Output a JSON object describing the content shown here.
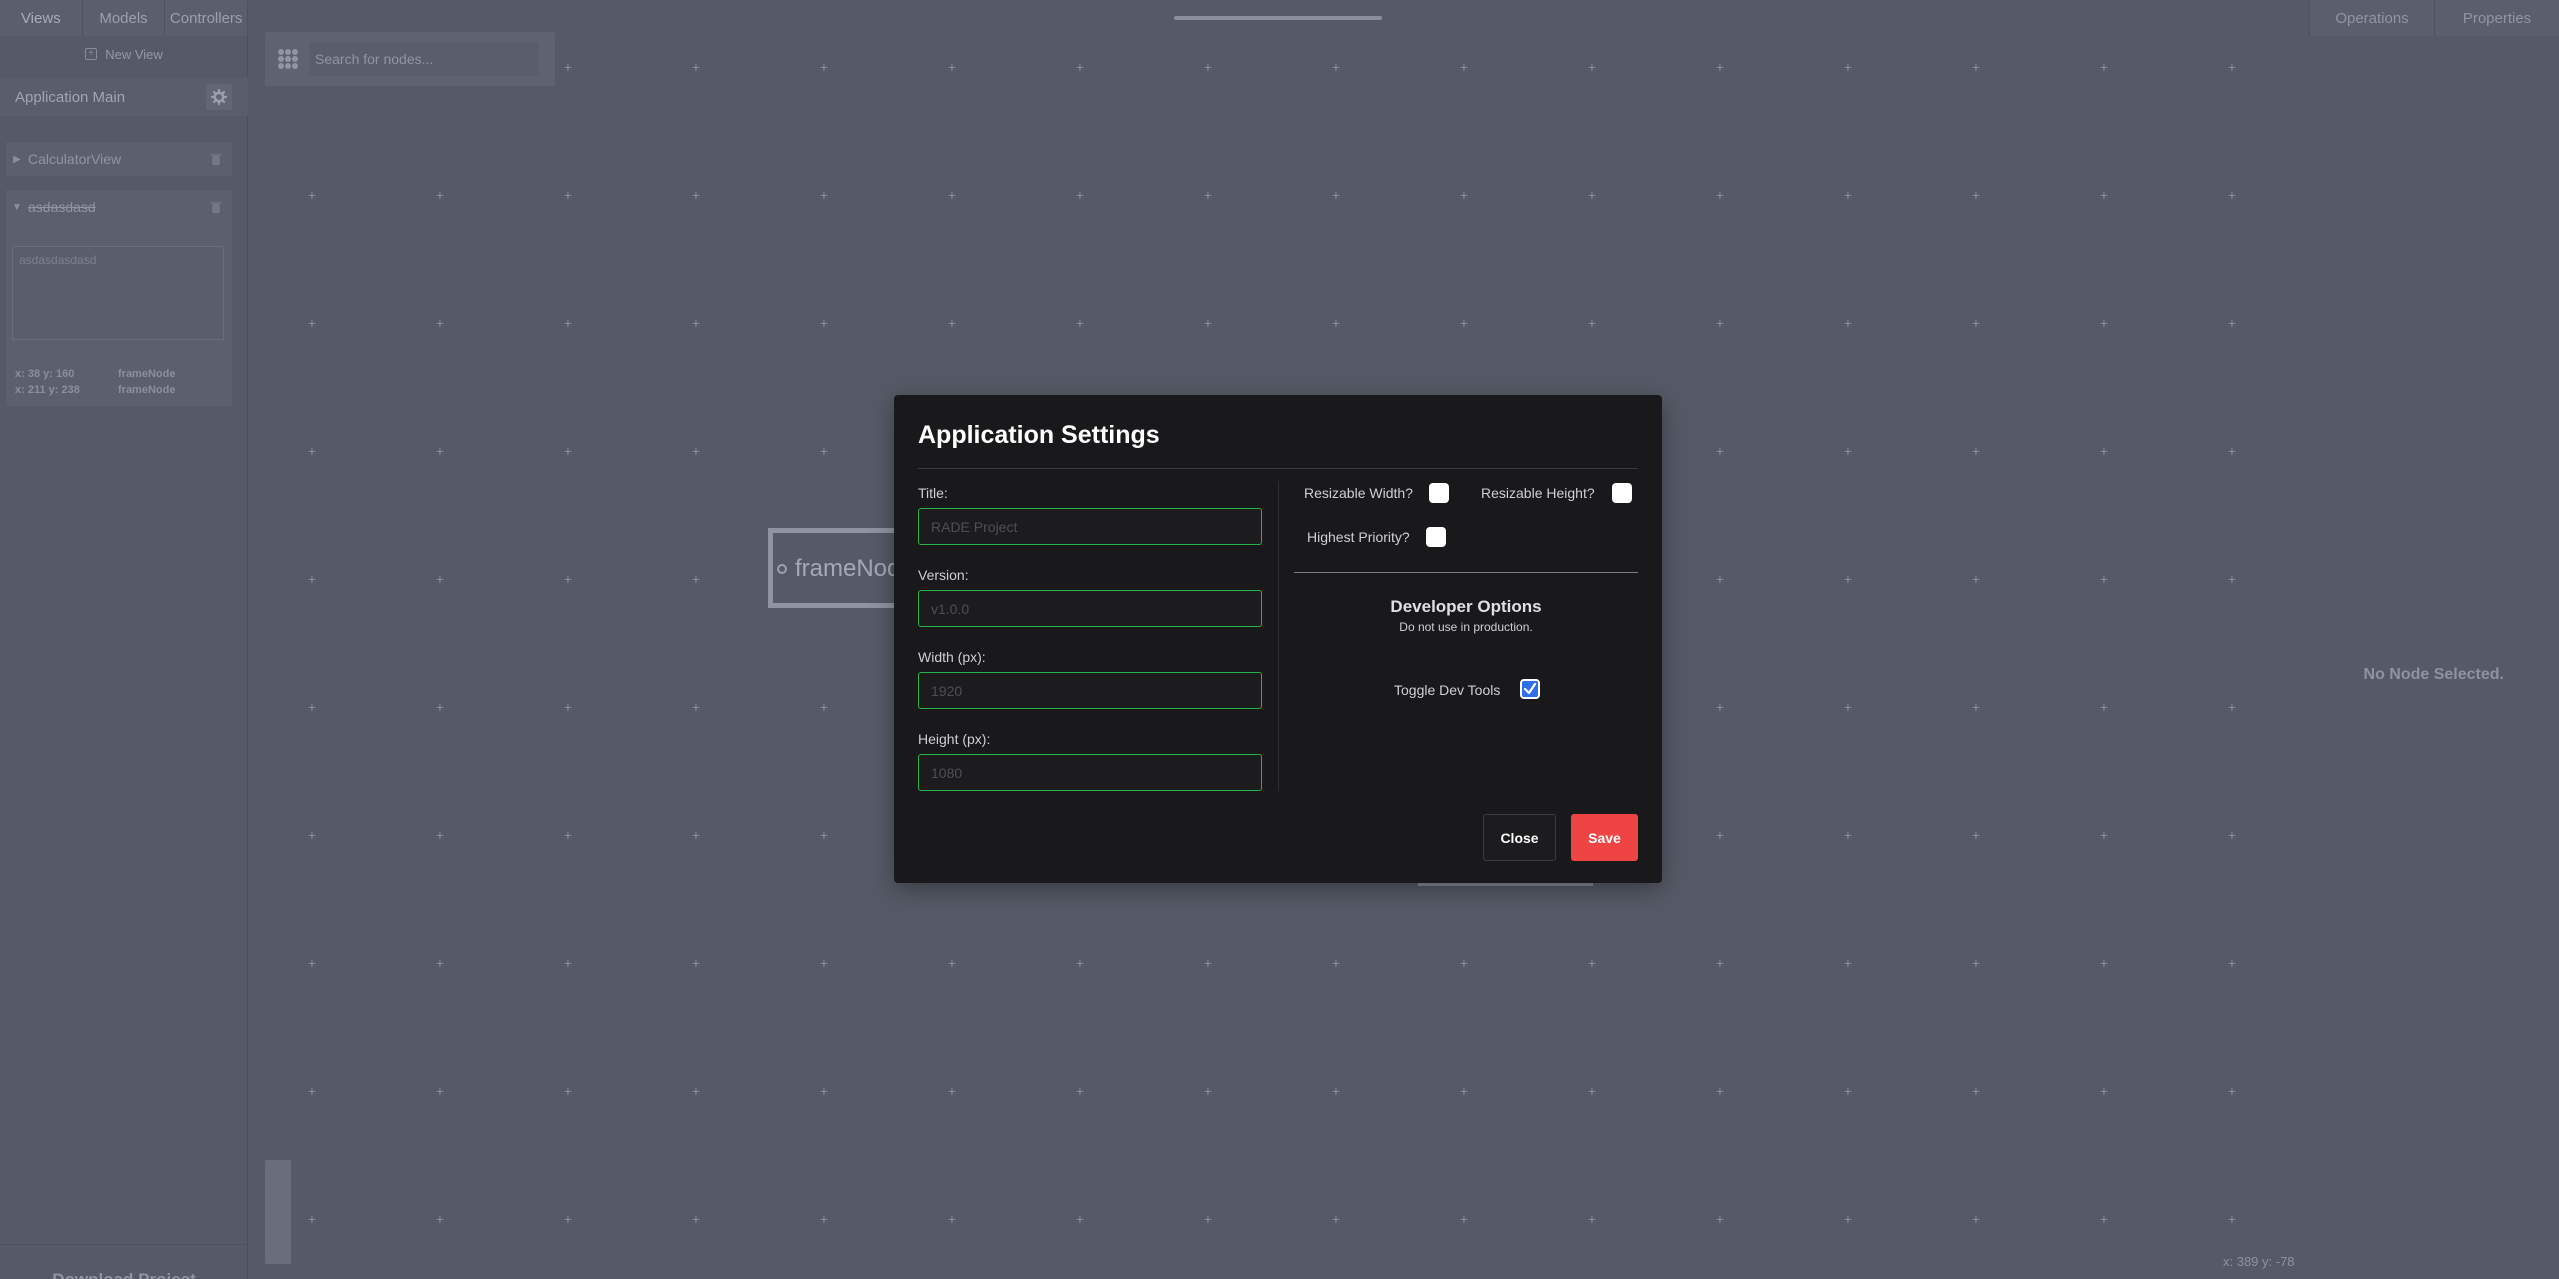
{
  "top_tabs_left": [
    "Views",
    "Models",
    "Controllers"
  ],
  "top_tabs_right": [
    "Operations",
    "Properties"
  ],
  "sidebar": {
    "new_view_label": "New View",
    "app_main_label": "Application Main",
    "views": [
      {
        "name": "CalculatorView",
        "expanded": false
      },
      {
        "name": "asdasdasd",
        "expanded": true
      }
    ],
    "view_textarea_value": "asdasdasdasd",
    "node_positions": [
      {
        "coords": "x: 38 y: 160",
        "node": "frameNode"
      },
      {
        "coords": "x: 211 y: 238",
        "node": "frameNode"
      }
    ],
    "download_label": "Download Project"
  },
  "canvas": {
    "search_placeholder": "Search for nodes...",
    "frame_node_label": "frameNode",
    "no_node_text": "No Node Selected.",
    "coords_readout": "x: 389 y: -78"
  },
  "modal": {
    "title": "Application Settings",
    "fields": [
      {
        "label": "Title:",
        "placeholder": "RADE Project"
      },
      {
        "label": "Version:",
        "placeholder": "v1.0.0"
      },
      {
        "label": "Width (px):",
        "placeholder": "1920"
      },
      {
        "label": "Height (px):",
        "placeholder": "1080"
      }
    ],
    "checks": {
      "resizable_width": {
        "label": "Resizable Width?",
        "checked": false
      },
      "resizable_height": {
        "label": "Resizable Height?",
        "checked": false
      },
      "highest_priority": {
        "label": "Highest Priority?",
        "checked": false
      },
      "dev_tools": {
        "label": "Toggle Dev Tools",
        "checked": true
      }
    },
    "dev_title": "Developer Options",
    "dev_subtitle": "Do not use in production.",
    "close_label": "Close",
    "save_label": "Save",
    "colors": {
      "field_border": "#27b24a",
      "save_button": "#ef4444",
      "checkbox_checked": "#2f6fe8"
    }
  }
}
